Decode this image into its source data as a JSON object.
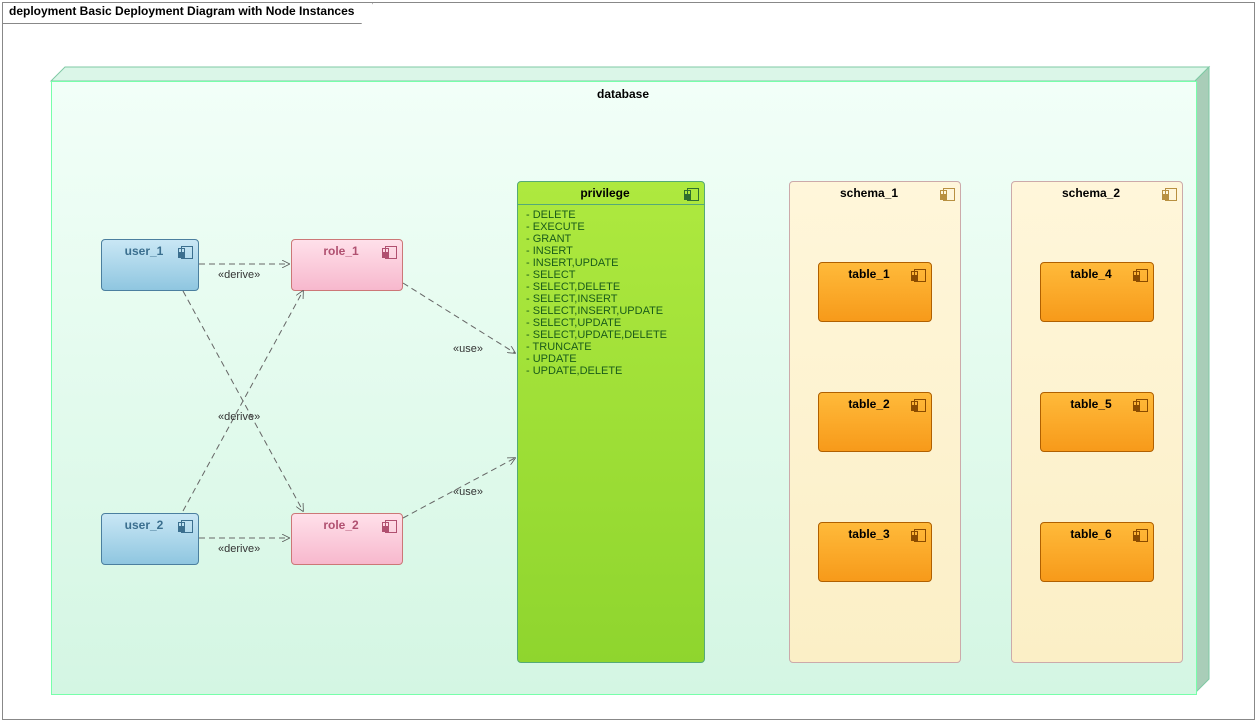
{
  "diagram": {
    "title": "deployment Basic Deployment Diagram with Node Instances",
    "container": "database"
  },
  "users": [
    "user_1",
    "user_2"
  ],
  "roles": [
    "role_1",
    "role_2"
  ],
  "relations": {
    "derive": "«derive»",
    "use": "«use»"
  },
  "privilege": {
    "title": "privilege",
    "items": [
      "DELETE",
      "EXECUTE",
      "GRANT",
      "INSERT",
      "INSERT,UPDATE",
      "SELECT",
      "SELECT,DELETE",
      "SELECT,INSERT",
      "SELECT,INSERT,UPDATE",
      "SELECT,UPDATE",
      "SELECT,UPDATE,DELETE",
      "TRUNCATE",
      "UPDATE",
      "UPDATE,DELETE"
    ]
  },
  "schemas": [
    {
      "name": "schema_1",
      "tables": [
        "table_1",
        "table_2",
        "table_3"
      ]
    },
    {
      "name": "schema_2",
      "tables": [
        "table_4",
        "table_5",
        "table_6"
      ]
    }
  ],
  "chart_data": {
    "type": "table",
    "title": "deployment Basic Deployment Diagram with Node Instances",
    "container": "database",
    "nodes": [
      {
        "id": "user_1",
        "kind": "user"
      },
      {
        "id": "user_2",
        "kind": "user"
      },
      {
        "id": "role_1",
        "kind": "role"
      },
      {
        "id": "role_2",
        "kind": "role"
      },
      {
        "id": "privilege",
        "kind": "privilege",
        "attributes": [
          "DELETE",
          "EXECUTE",
          "GRANT",
          "INSERT",
          "INSERT,UPDATE",
          "SELECT",
          "SELECT,DELETE",
          "SELECT,INSERT",
          "SELECT,INSERT,UPDATE",
          "SELECT,UPDATE",
          "SELECT,UPDATE,DELETE",
          "TRUNCATE",
          "UPDATE",
          "UPDATE,DELETE"
        ]
      },
      {
        "id": "schema_1",
        "kind": "schema",
        "children": [
          "table_1",
          "table_2",
          "table_3"
        ]
      },
      {
        "id": "schema_2",
        "kind": "schema",
        "children": [
          "table_4",
          "table_5",
          "table_6"
        ]
      },
      {
        "id": "table_1",
        "kind": "table"
      },
      {
        "id": "table_2",
        "kind": "table"
      },
      {
        "id": "table_3",
        "kind": "table"
      },
      {
        "id": "table_4",
        "kind": "table"
      },
      {
        "id": "table_5",
        "kind": "table"
      },
      {
        "id": "table_6",
        "kind": "table"
      }
    ],
    "edges": [
      {
        "from": "user_1",
        "to": "role_1",
        "stereotype": "derive"
      },
      {
        "from": "user_1",
        "to": "role_2",
        "stereotype": "derive"
      },
      {
        "from": "user_2",
        "to": "role_1",
        "stereotype": "derive"
      },
      {
        "from": "user_2",
        "to": "role_2",
        "stereotype": "derive"
      },
      {
        "from": "role_1",
        "to": "privilege",
        "stereotype": "use"
      },
      {
        "from": "role_2",
        "to": "privilege",
        "stereotype": "use"
      }
    ]
  }
}
